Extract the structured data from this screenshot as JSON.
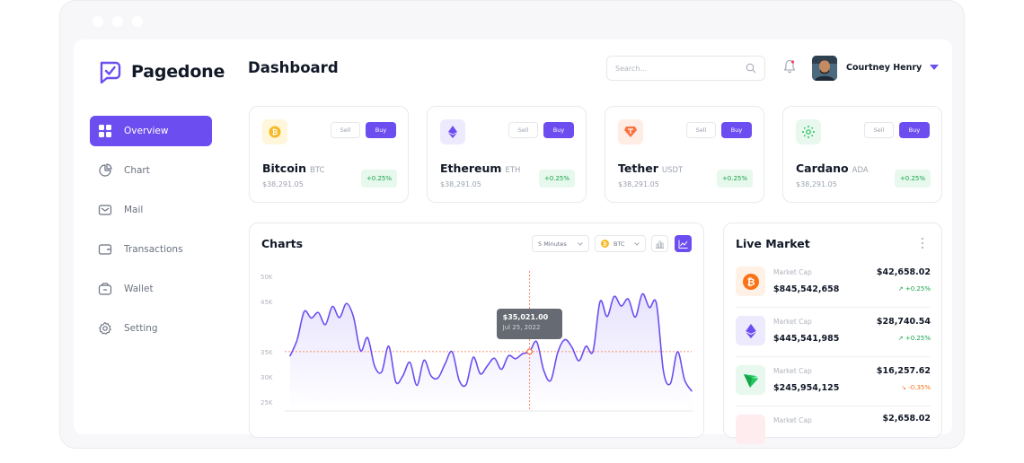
{
  "brand": {
    "name": "Pagedone",
    "accent": "#6c4ef0"
  },
  "sidebar": {
    "items": [
      {
        "label": "Overview",
        "icon": "grid-icon",
        "active": true
      },
      {
        "label": "Chart",
        "icon": "pie-chart-icon",
        "active": false
      },
      {
        "label": "Mail",
        "icon": "mail-icon",
        "active": false
      },
      {
        "label": "Transactions",
        "icon": "card-icon",
        "active": false
      },
      {
        "label": "Wallet",
        "icon": "wallet-icon",
        "active": false
      },
      {
        "label": "Setting",
        "icon": "gear-icon",
        "active": false
      }
    ]
  },
  "header": {
    "title": "Dashboard",
    "search_placeholder": "Search...",
    "user_name": "Courtney Henry"
  },
  "coins": [
    {
      "name": "Bitcoin",
      "ticker": "BTC",
      "price": "$38,291.05",
      "change": "+0.25%",
      "sell": "Sell",
      "buy": "Buy",
      "icon": "bitcoin-icon",
      "color": "#f7b924",
      "bg": "#fff6dc"
    },
    {
      "name": "Ethereum",
      "ticker": "ETH",
      "price": "$38,291.05",
      "change": "+0.25%",
      "sell": "Sell",
      "buy": "Buy",
      "icon": "ethereum-icon",
      "color": "#6c4ef0",
      "bg": "#eeeafd"
    },
    {
      "name": "Tether",
      "ticker": "USDT",
      "price": "$38,291.05",
      "change": "+0.25%",
      "sell": "Sell",
      "buy": "Buy",
      "icon": "tether-icon",
      "color": "#f97341",
      "bg": "#ffece4"
    },
    {
      "name": "Cardano",
      "ticker": "ADA",
      "price": "$38,291.05",
      "change": "+0.25%",
      "sell": "Sell",
      "buy": "Buy",
      "icon": "cardano-icon",
      "color": "#22c55e",
      "bg": "#e8f8ee"
    }
  ],
  "charts": {
    "title": "Charts",
    "interval": "5 Minutes",
    "coin": "BTC",
    "tooltip": {
      "value": "$35,021.00",
      "date": "Jul 25, 2022"
    },
    "y_ticks": [
      "50K",
      "45K",
      "35K",
      "30K",
      "25K"
    ]
  },
  "chart_data": {
    "type": "line",
    "ylim": [
      25000,
      50000
    ],
    "y_ticks": [
      "50K",
      "45K",
      "35K",
      "30K",
      "25K"
    ],
    "series": [
      {
        "values": [
          34200,
          37400,
          43000,
          41700,
          42800,
          40400,
          44000,
          41800,
          44600,
          41900,
          35200,
          37800,
          32100,
          31000,
          36100,
          29000,
          30200,
          32900,
          28300,
          33300,
          30200,
          29800,
          32600,
          35000,
          29300,
          28500,
          33900,
          30600,
          32200,
          33700,
          31500,
          34200,
          33600,
          34600,
          35021,
          37000,
          31300,
          29300,
          34900,
          37400,
          35900,
          33200,
          36100,
          35100,
          45000,
          42000,
          46000,
          44100,
          45500,
          41900,
          46500,
          43800,
          44600,
          31100,
          28700,
          35000,
          29400,
          27200
        ]
      }
    ],
    "highlight": {
      "value": 35021,
      "label": "$35,021.00",
      "date": "Jul 25, 2022"
    }
  },
  "market": {
    "title": "Live Market",
    "rows": [
      {
        "label": "Market Cap",
        "value": "$845,542,658",
        "price": "$42,658.02",
        "change": "+0.25%",
        "direction": "up",
        "icon": "bitcoin-icon",
        "color": "#f97316",
        "bg": "#fff1e6"
      },
      {
        "label": "Market Cap",
        "value": "$445,541,985",
        "price": "$28,740.54",
        "change": "+0.25%",
        "direction": "up",
        "icon": "ethereum-icon",
        "color": "#6c4ef0",
        "bg": "#eeeafd"
      },
      {
        "label": "Market Cap",
        "value": "$245,954,125",
        "price": "$16,257.62",
        "change": "-0.35%",
        "direction": "down",
        "icon": "tron-icon",
        "color": "#22c55e",
        "bg": "#e8f8ee"
      },
      {
        "label": "Market Cap",
        "value": "",
        "price": "$2,658.02",
        "change": "",
        "direction": "up",
        "icon": "coin-icon",
        "color": "#f43f5e",
        "bg": "#feecef"
      }
    ],
    "up_color": "#16a34a",
    "down_color": "#f97316"
  }
}
